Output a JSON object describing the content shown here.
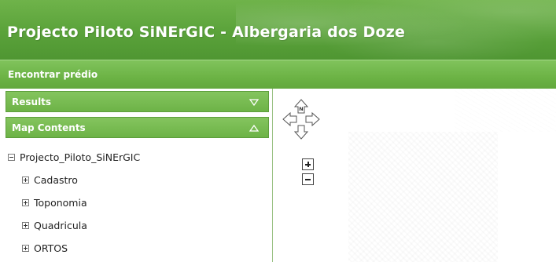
{
  "header": {
    "title": "Projecto Piloto SiNErGIC - Albergaria dos Doze"
  },
  "toolbar": {
    "find_parcel_label": "Encontrar prédio"
  },
  "panels": {
    "results": {
      "label": "Results",
      "toggle_icon": "triangle-down-icon"
    },
    "map_contents": {
      "label": "Map Contents",
      "toggle_icon": "triangle-up-icon"
    }
  },
  "tree": {
    "root": {
      "label": "Projecto_Piloto_SiNErGIC",
      "state": "expanded"
    },
    "layers": [
      {
        "label": "Cadastro",
        "state": "collapsed"
      },
      {
        "label": "Toponomia",
        "state": "collapsed"
      },
      {
        "label": "Quadricula",
        "state": "collapsed"
      },
      {
        "label": "ORTOS",
        "state": "collapsed"
      }
    ]
  },
  "map": {
    "compass_label": "N",
    "icons": [
      "pan-arrows-icon",
      "zoom-in-icon",
      "zoom-out-icon"
    ]
  },
  "colors": {
    "header_green": "#5aa23a",
    "panel_green": "#6db347",
    "text": "#222222"
  }
}
